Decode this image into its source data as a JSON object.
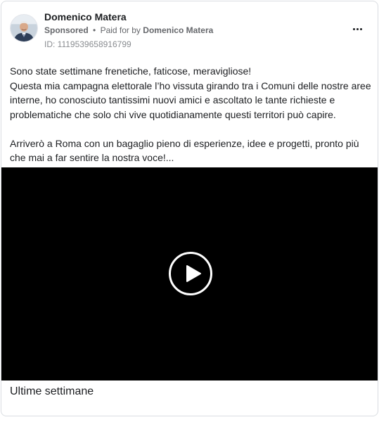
{
  "post": {
    "author": "Domenico Matera",
    "sponsored_label": "Sponsored",
    "separator": "•",
    "paid_for_prefix": "Paid for by",
    "paid_for_name": "Domenico Matera",
    "ad_id": "ID: 1119539658916799",
    "more_icon": "more-horizontal-icon",
    "body_lines": [
      "Sono state settimane frenetiche, faticose, meravigliose!",
      "Questa mia campagna elettorale l’ho vissuta girando tra i Comuni delle nostre aree interne, ho conosciuto tantissimi nuovi amici e ascoltato le tante richieste e problematiche che solo chi vive quotidianamente questi territori può capire.",
      "Arriverò a Roma con un bagaglio pieno di esperienze, idee e progetti, pronto più che mai a far sentire la nostra voce!..."
    ],
    "video": {
      "play_icon": "play-icon",
      "background": "#000000"
    },
    "caption": "Ultime settimane"
  }
}
